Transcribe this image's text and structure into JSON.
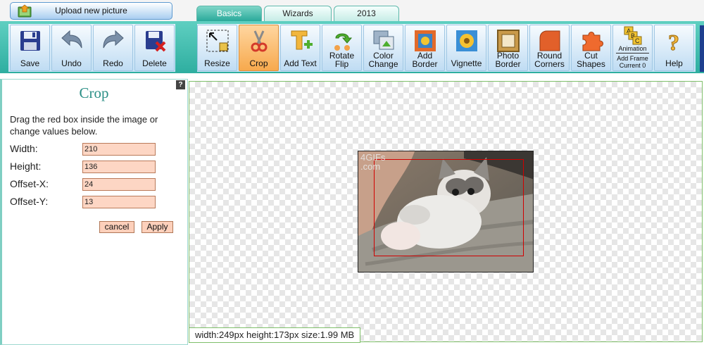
{
  "header": {
    "upload_label": "Upload new picture",
    "tabs": [
      {
        "label": "Basics",
        "active": true
      },
      {
        "label": "Wizards",
        "active": false
      },
      {
        "label": "2013",
        "active": false
      }
    ]
  },
  "toolbar": {
    "file_tools": [
      {
        "label": "Save",
        "icon": "floppy-disk-icon"
      },
      {
        "label": "Undo",
        "icon": "undo-arrow-icon"
      },
      {
        "label": "Redo",
        "icon": "redo-arrow-icon"
      },
      {
        "label": "Delete",
        "icon": "delete-icon"
      }
    ],
    "edit_tools": [
      {
        "label": "Resize",
        "icon": "resize-icon"
      },
      {
        "label": "Crop",
        "icon": "scissors-icon",
        "active": true
      },
      {
        "label": "Add Text",
        "icon": "add-text-icon"
      },
      {
        "label_line1": "Rotate",
        "label_line2": "Flip",
        "icon": "rotate-flip-icon"
      },
      {
        "label_line1": "Color",
        "label_line2": "Change",
        "icon": "color-change-icon"
      },
      {
        "label_line1": "Add",
        "label_line2": "Border",
        "icon": "add-border-icon"
      },
      {
        "label": "Vignette",
        "icon": "vignette-icon"
      },
      {
        "label_line1": "Photo",
        "label_line2": "Border",
        "icon": "photo-border-icon"
      },
      {
        "label_line1": "Round",
        "label_line2": "Corners",
        "icon": "round-corners-icon"
      },
      {
        "label_line1": "Cut",
        "label_line2": "Shapes",
        "icon": "cut-shapes-icon"
      },
      {
        "label_line1": "Animation",
        "label_line2": "Add Frame",
        "label_line3": "Current 0",
        "icon": "animation-frames-icon"
      },
      {
        "label": "Help",
        "icon": "help-icon"
      }
    ]
  },
  "crop_panel": {
    "title": "Crop",
    "description": "Drag the red box inside the image or change values below.",
    "fields": [
      {
        "label": "Width:",
        "value": "210"
      },
      {
        "label": "Height:",
        "value": "136"
      },
      {
        "label": "Offset-X:",
        "value": "24"
      },
      {
        "label": "Offset-Y:",
        "value": "13"
      }
    ],
    "cancel_label": "cancel",
    "apply_label": "Apply",
    "help_label": "?"
  },
  "canvas": {
    "watermark_line1": "4GIFs",
    "watermark_line2": ".com",
    "status": "width:249px  height:173px  size:1.99 MB"
  },
  "colors": {
    "toolbar_teal": "#2eaea0",
    "active_tool": "#f7a94d",
    "panel_title": "#2b8f86",
    "crop_box": "#d10000",
    "input_fill": "#fdd6c4"
  }
}
